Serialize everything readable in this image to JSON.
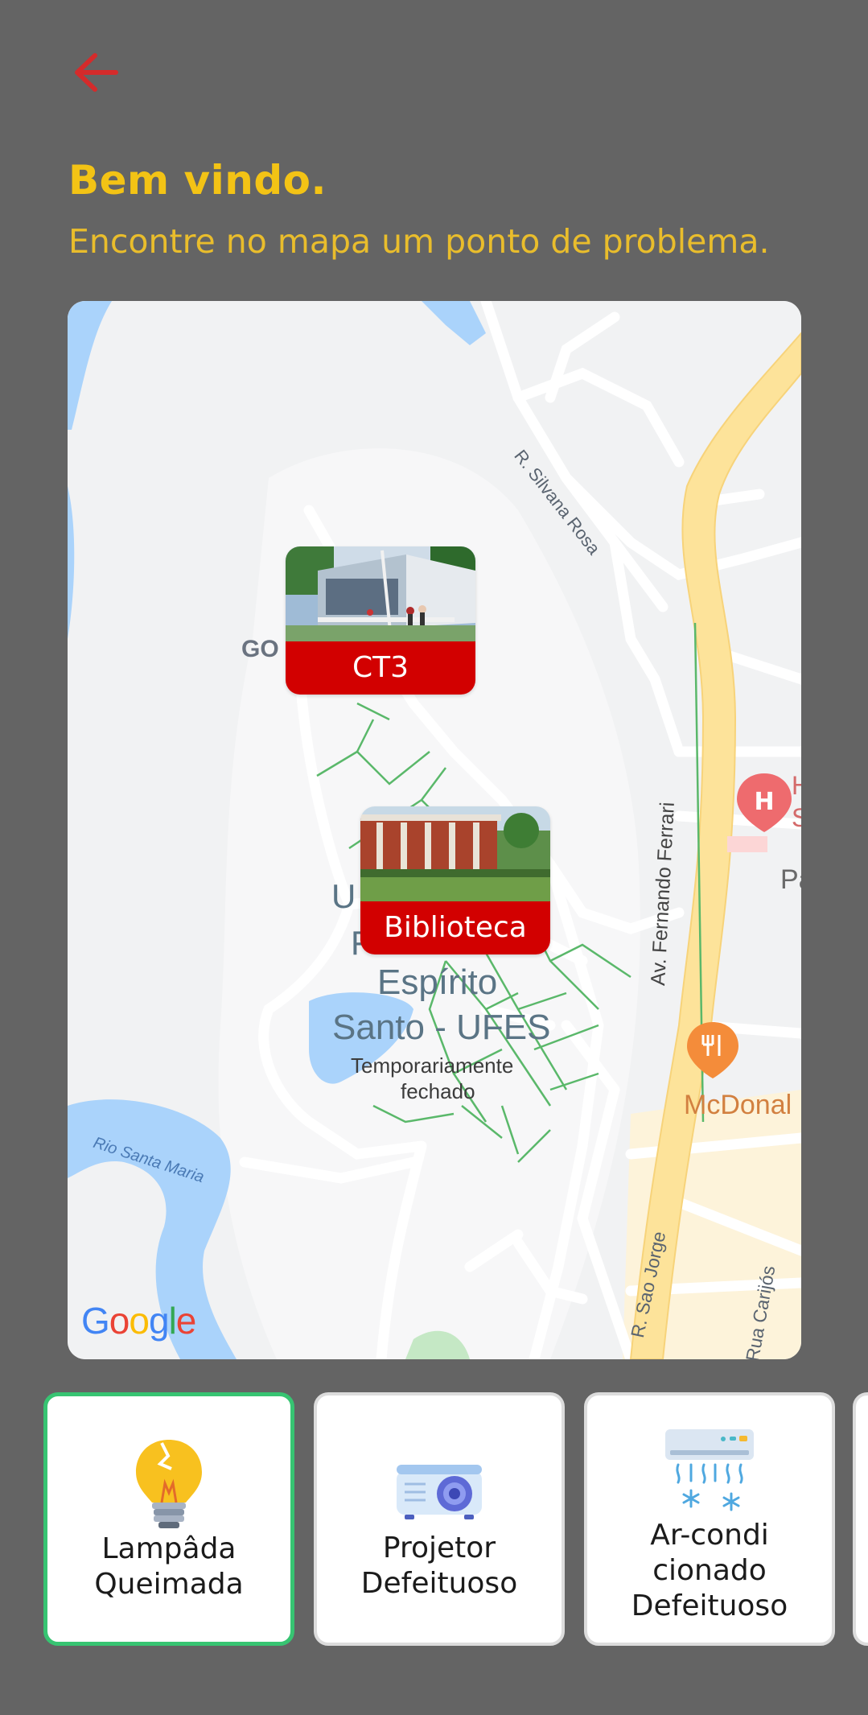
{
  "header": {
    "title": "Bem vindo.",
    "subtitle": "Encontre no mapa um ponto de problema."
  },
  "map": {
    "markers": [
      {
        "label": "CT3"
      },
      {
        "label": "Biblioteca"
      }
    ],
    "labels": {
      "street_silvana": "R. Silvana Rosa",
      "street_ferrari": "Av. Fernando Ferrari",
      "street_jorge": "R. Sao Jorge",
      "street_carijos": "Rua Carijós",
      "river": "Rio Santa Maria",
      "place_gol": "GO",
      "place_univ_1": "U",
      "place_univ_2": "F",
      "place_univ_3": "Espírito",
      "place_univ_4": "Santo - UFES",
      "closed_1": "Temporariamente",
      "closed_2": "fechado",
      "hospital_h": "H",
      "hospital_s": "S",
      "pa": "Pa",
      "mcdonalds": "McDonal",
      "google": "Google"
    }
  },
  "problem_types": [
    {
      "line1": "Lampâda",
      "line2": "Queimada",
      "line3": "",
      "icon": "broken-lightbulb-icon",
      "selected": true
    },
    {
      "line1": "Projetor",
      "line2": "Defeituoso",
      "line3": "",
      "icon": "projector-icon",
      "selected": false
    },
    {
      "line1": "Ar-condi",
      "line2": "cionado",
      "line3": "Defeituoso",
      "icon": "air-conditioner-icon",
      "selected": false
    }
  ],
  "colors": {
    "background": "#646464",
    "accent_yellow": "#f3c315",
    "marker_red": "#d20000",
    "selected_border": "#37c472",
    "back_arrow": "#d42b2b"
  }
}
